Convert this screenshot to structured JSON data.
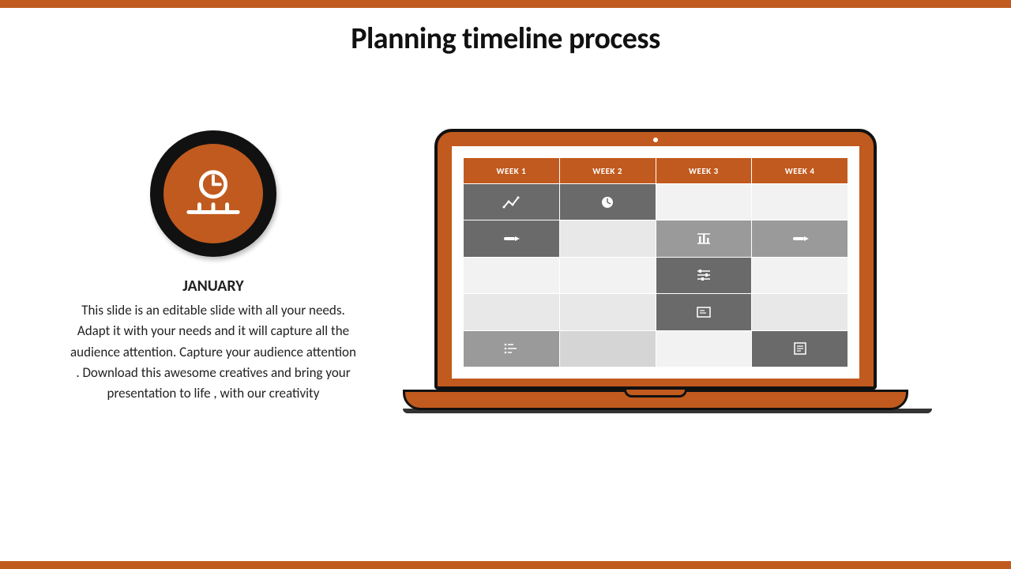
{
  "title": "Planning timeline process",
  "month": "JANUARY",
  "description": "This slide is an editable slide with all your needs. Adapt it with your needs and it will capture all the audience attention. Capture your audience attention . Download this awesome creatives and bring your presentation to life , with our creativity",
  "weeks": [
    "WEEK 1",
    "WEEK 2",
    "WEEK 3",
    "WEEK 4"
  ],
  "grid_rows": [
    [
      {
        "on": true,
        "icon": "trend"
      },
      {
        "on": true,
        "icon": "clock"
      },
      {
        "on": false
      },
      {
        "on": false
      }
    ],
    [
      {
        "on": true,
        "icon": "pen"
      },
      {
        "on": false
      },
      {
        "on": true,
        "light": true,
        "icon": "chart-bars"
      },
      {
        "on": true,
        "light": true,
        "icon": "pen"
      }
    ],
    [
      {
        "on": false
      },
      {
        "on": false
      },
      {
        "on": true,
        "icon": "sliders"
      },
      {
        "on": false
      }
    ],
    [
      {
        "on": false
      },
      {
        "on": false
      },
      {
        "on": true,
        "icon": "panel"
      },
      {
        "on": false
      }
    ],
    [
      {
        "on": true,
        "light": true,
        "icon": "list"
      },
      {
        "on": false,
        "light": true
      },
      {
        "on": false
      },
      {
        "on": true,
        "icon": "document"
      }
    ]
  ],
  "colors": {
    "accent": "#c15a1e",
    "dark": "#111"
  }
}
